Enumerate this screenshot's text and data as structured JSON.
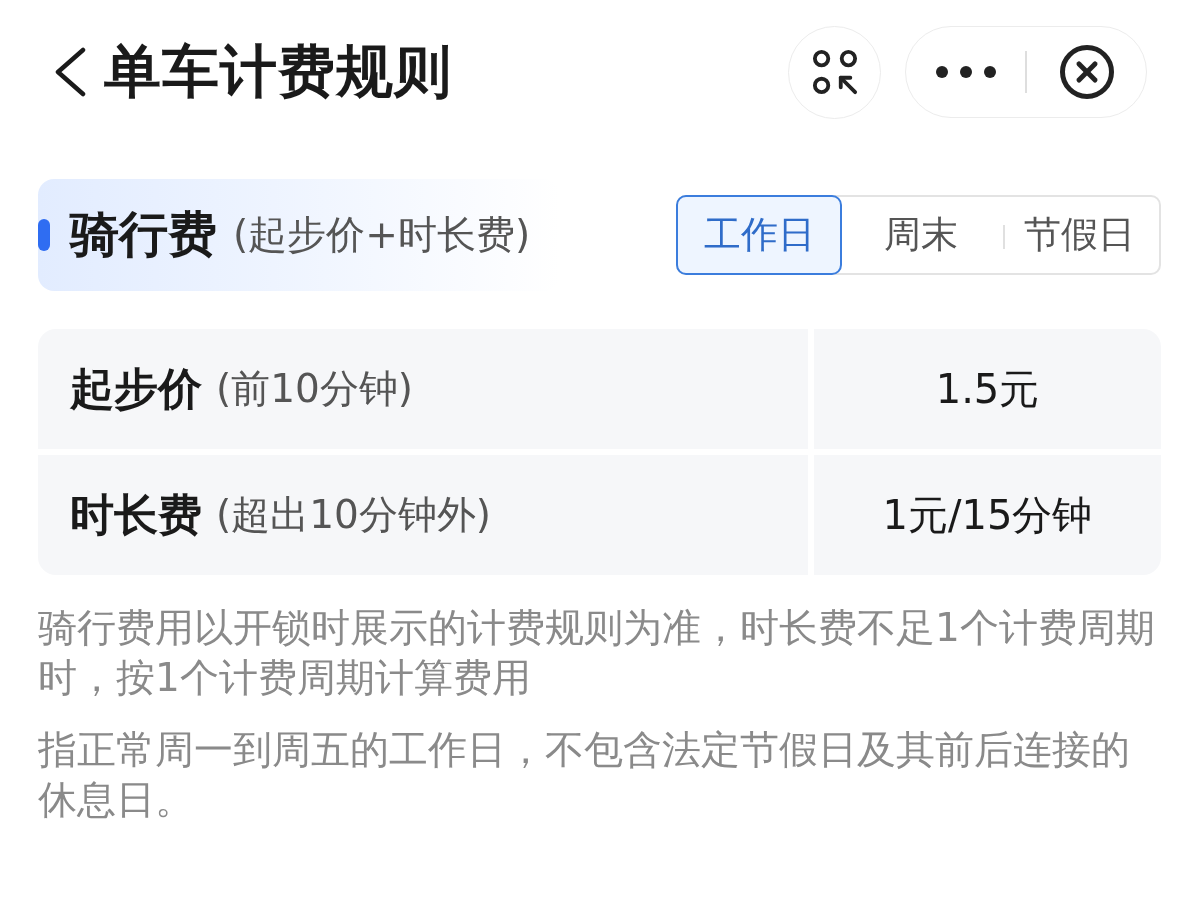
{
  "header": {
    "title": "单车计费规则"
  },
  "section": {
    "title": "骑行费",
    "subtitle": "(起步价+时长费)"
  },
  "day_tabs": [
    {
      "label": "工作日",
      "selected": true
    },
    {
      "label": "周末",
      "selected": false
    },
    {
      "label": "节假日",
      "selected": false
    }
  ],
  "fee_table": {
    "rows": [
      {
        "name": "起步价",
        "note": "(前10分钟)",
        "value": "1.5元"
      },
      {
        "name": "时长费",
        "note": "(超出10分钟外)",
        "value": "1元/15分钟"
      }
    ]
  },
  "notes": [
    "骑行费用以开锁时展示的计费规则为准，时长费不足1个计费周期时，按1个计费周期计算费用",
    "指正常周一到周五的工作日，不包含法定节假日及其前后连接的休息日。"
  ]
}
